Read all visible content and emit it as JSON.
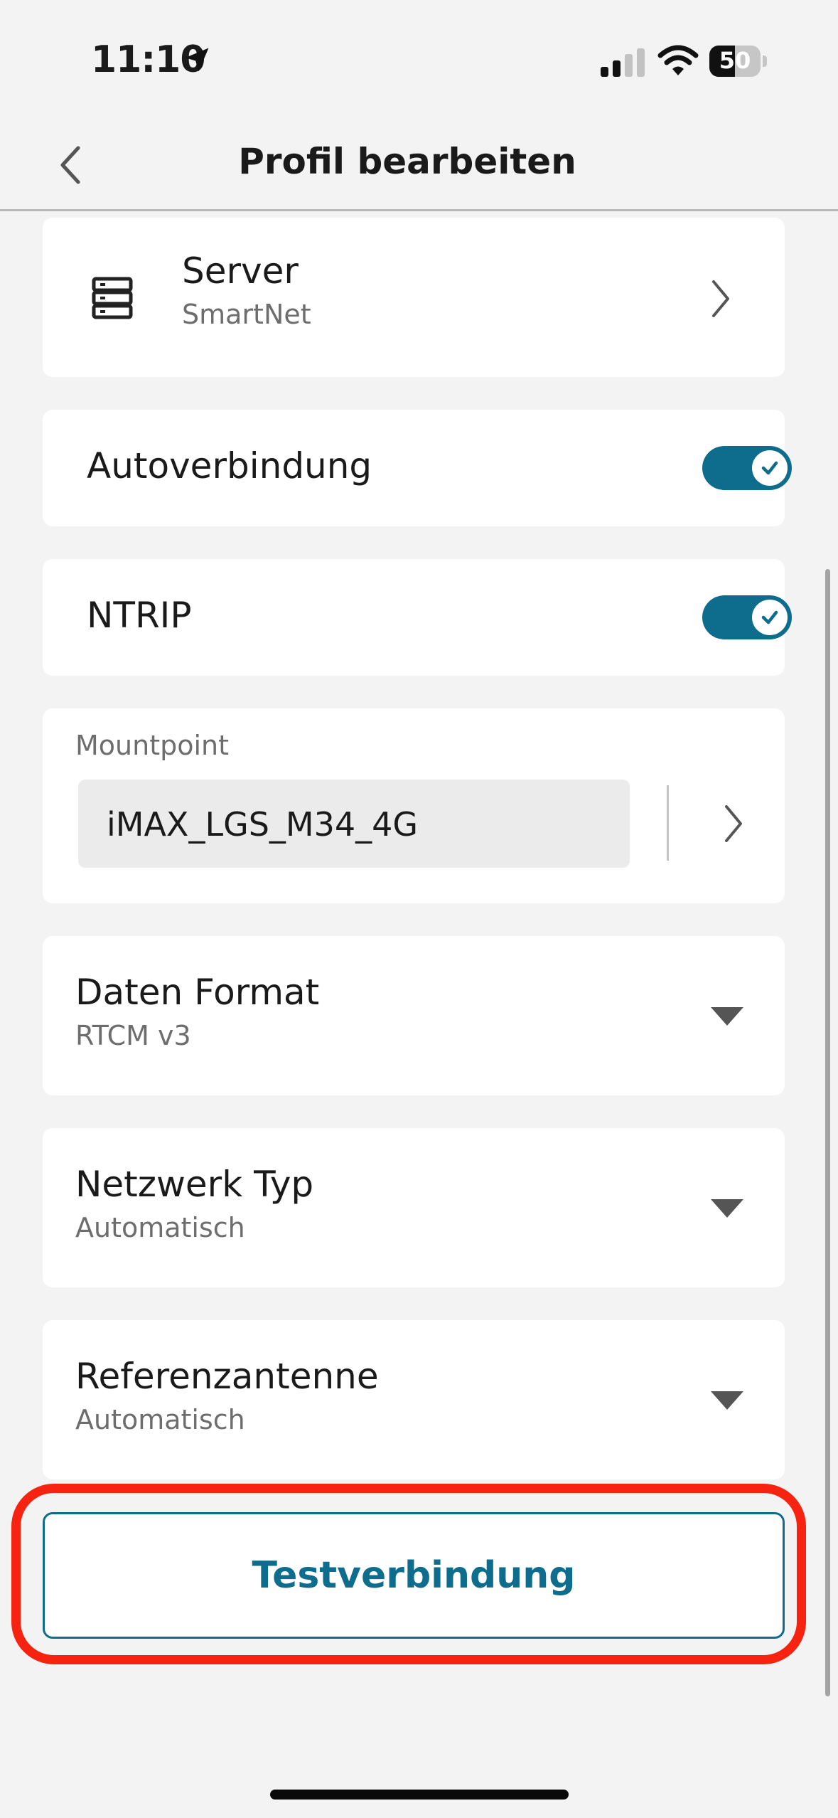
{
  "status_bar": {
    "time": "11:10",
    "battery_label": "50",
    "battery_level": 0.5,
    "location_icon": "location-arrow-icon",
    "signal_icon": "cellular-signal-icon",
    "wifi_icon": "wifi-icon",
    "battery_icon": "battery-icon"
  },
  "header": {
    "title": "Profil bearbeiten",
    "back_icon": "chevron-left-icon"
  },
  "server": {
    "title": "Server",
    "value": "SmartNet",
    "icon": "server-icon"
  },
  "autoverbindung": {
    "label": "Autoverbindung",
    "enabled": true
  },
  "ntrip": {
    "label": "NTRIP",
    "enabled": true
  },
  "mountpoint": {
    "label": "Mountpoint",
    "value": "iMAX_LGS_M34_4G"
  },
  "daten_format": {
    "title": "Daten Format",
    "value": "RTCM v3"
  },
  "netzwerk_typ": {
    "title": "Netzwerk Typ",
    "value": "Automatisch"
  },
  "referenzantenne": {
    "title": "Referenzantenne",
    "value": "Automatisch"
  },
  "test_button": {
    "label": "Testverbindung"
  },
  "colors": {
    "accent": "#0e6c8c",
    "highlight": "#f5230f",
    "background": "#f3f3f3"
  }
}
